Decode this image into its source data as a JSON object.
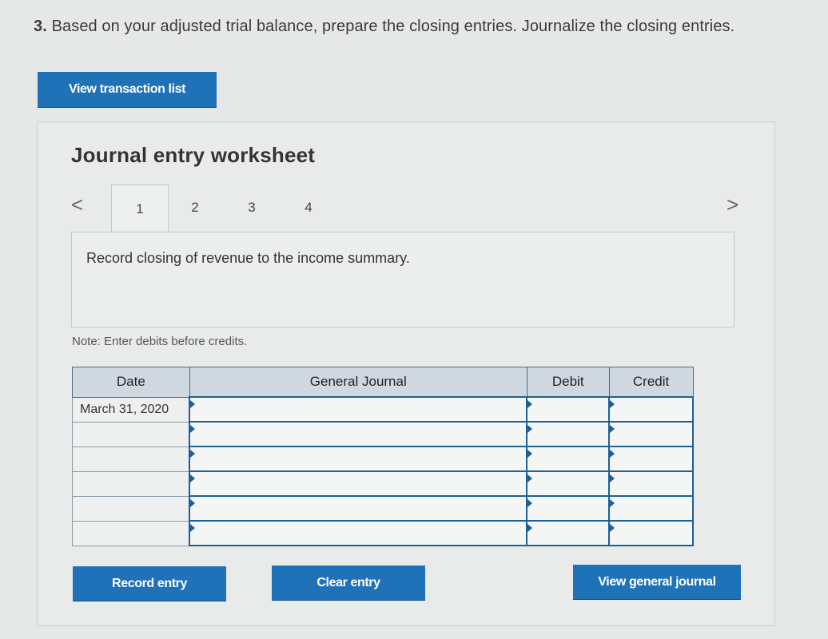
{
  "question": {
    "number": "3.",
    "text": "Based on your adjusted trial balance, prepare the closing entries. Journalize the closing entries."
  },
  "buttons": {
    "view_transaction_list": "View transaction list",
    "record_entry": "Record entry",
    "clear_entry": "Clear entry",
    "view_general_journal": "View general journal"
  },
  "worksheet": {
    "title": "Journal entry worksheet",
    "nav_prev": "<",
    "nav_next": ">",
    "tabs": [
      "1",
      "2",
      "3",
      "4"
    ],
    "active_tab": 0,
    "description": "Record closing of revenue to the income summary.",
    "note": "Note: Enter debits before credits."
  },
  "journal": {
    "headers": {
      "date": "Date",
      "general_journal": "General Journal",
      "debit": "Debit",
      "credit": "Credit"
    },
    "rows": [
      {
        "date": "March 31, 2020",
        "account": "",
        "debit": "",
        "credit": ""
      },
      {
        "date": "",
        "account": "",
        "debit": "",
        "credit": ""
      },
      {
        "date": "",
        "account": "",
        "debit": "",
        "credit": ""
      },
      {
        "date": "",
        "account": "",
        "debit": "",
        "credit": ""
      },
      {
        "date": "",
        "account": "",
        "debit": "",
        "credit": ""
      },
      {
        "date": "",
        "account": "",
        "debit": "",
        "credit": ""
      }
    ]
  },
  "colors": {
    "button_blue": "#1f72b8",
    "header_fill": "#cfd8e0",
    "input_border": "#1f5f95",
    "page_bg": "#e6e8e8"
  }
}
